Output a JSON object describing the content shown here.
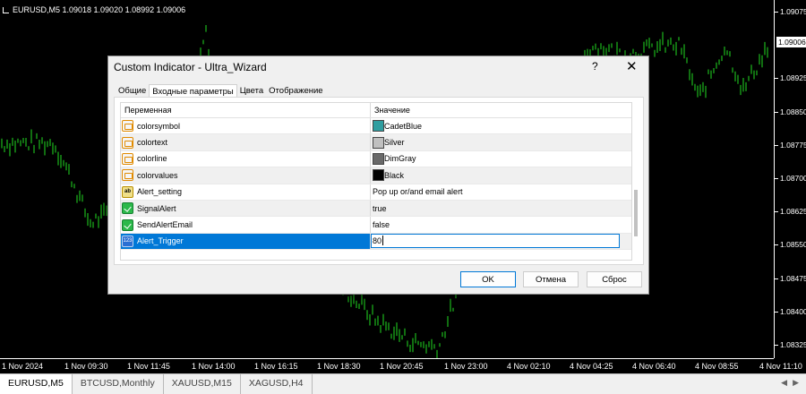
{
  "chart": {
    "header": "EURUSD,M5  1.09018 1.09020 1.08992 1.09006",
    "price_ticks": [
      "1.09075",
      "1.09006",
      "1.08925",
      "1.08850",
      "1.08775",
      "1.08700",
      "1.08625",
      "1.08550",
      "1.08475",
      "1.08400",
      "1.08325"
    ],
    "current_price": "1.09006",
    "time_ticks": [
      "1 Nov 2024",
      "1 Nov 09:30",
      "1 Nov 11:45",
      "1 Nov 14:00",
      "1 Nov 16:15",
      "1 Nov 18:30",
      "1 Nov 20:45",
      "1 Nov 23:00",
      "4 Nov 02:10",
      "4 Nov 04:25",
      "4 Nov 06:40",
      "4 Nov 08:55",
      "4 Nov 11:10"
    ],
    "candle_color": "#22dd22"
  },
  "symbol_tabs": [
    "EURUSD,M5",
    "BTCUSD,Monthly",
    "XAUUSD,M15",
    "XAGUSD,H4"
  ],
  "dialog": {
    "title": "Custom Indicator - Ultra_Wizard",
    "help": "?",
    "close": "✕",
    "tabs": [
      "Общие",
      "Входные параметры",
      "Цвета",
      "Отображение"
    ],
    "columns": [
      "Переменная",
      "Значение"
    ],
    "rows": [
      {
        "name": "colorsymbol",
        "value": "CadetBlue",
        "type": "color",
        "swatch": "#2f9ea0"
      },
      {
        "name": "colortext",
        "value": "Silver",
        "type": "color",
        "swatch": "#c0c0c0"
      },
      {
        "name": "colorline",
        "value": "DimGray",
        "type": "color",
        "swatch": "#696969"
      },
      {
        "name": "colorvalues",
        "value": "Black",
        "type": "color",
        "swatch": "#000000"
      },
      {
        "name": "Alert_setting",
        "value": "Pop up or/and email alert",
        "type": "string"
      },
      {
        "name": "SignalAlert",
        "value": "true",
        "type": "bool"
      },
      {
        "name": "SendAlertEmail",
        "value": "false",
        "type": "bool"
      },
      {
        "name": "Alert_Trigger",
        "value": "80",
        "type": "number"
      }
    ],
    "buttons": {
      "ok": "OK",
      "cancel": "Отмена",
      "reset": "Сброс"
    }
  }
}
